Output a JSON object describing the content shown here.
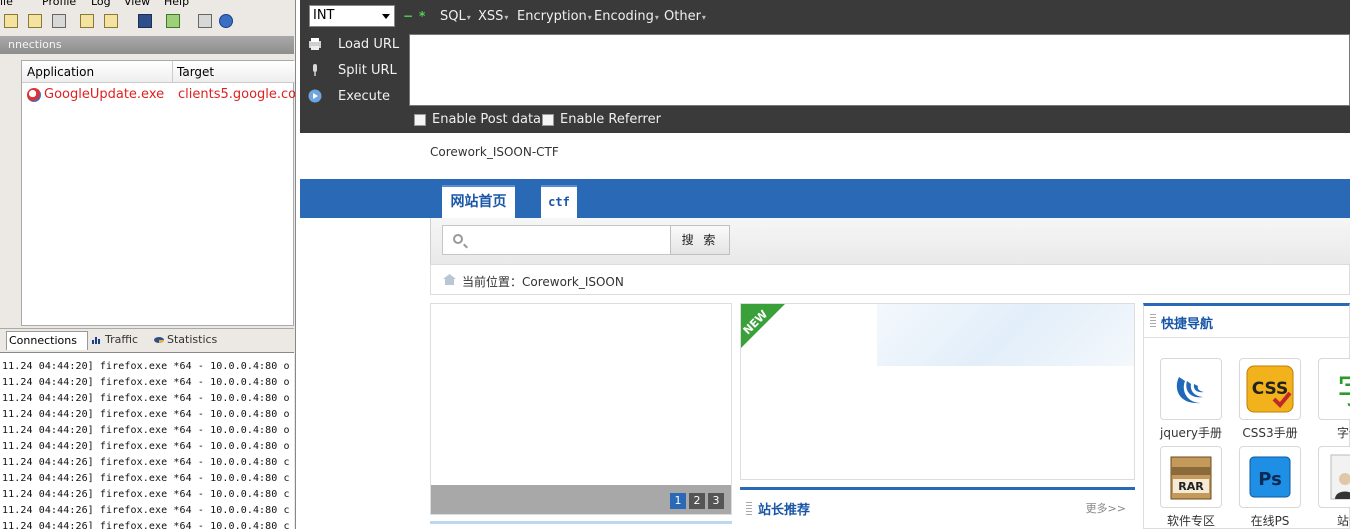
{
  "proxifier": {
    "menu": [
      "ile",
      "Profile",
      "Log",
      "View",
      "Help"
    ],
    "connections_title": "nnections",
    "table": {
      "columns": [
        "Application",
        "Target"
      ],
      "rows": [
        {
          "application": "GoogleUpdate.exe",
          "target": "clients5.google.com"
        }
      ]
    },
    "tabs": [
      "Connections",
      "Traffic",
      "Statistics"
    ],
    "log_lines": [
      "11.24 04:44:20] firefox.exe *64 - 10.0.0.4:80 o",
      "11.24 04:44:20] firefox.exe *64 - 10.0.0.4:80 o",
      "11.24 04:44:20] firefox.exe *64 - 10.0.0.4:80 o",
      "11.24 04:44:20] firefox.exe *64 - 10.0.0.4:80 o",
      "11.24 04:44:20] firefox.exe *64 - 10.0.0.4:80 o",
      "11.24 04:44:20] firefox.exe *64 - 10.0.0.4:80 o",
      "11.24 04:44:26] firefox.exe *64 - 10.0.0.4:80 c",
      "11.24 04:44:26] firefox.exe *64 - 10.0.0.4:80 c",
      "11.24 04:44:26] firefox.exe *64 - 10.0.0.4:80 c",
      "11.24 04:44:26] firefox.exe *64 - 10.0.0.4:80 c",
      "11.24 04:44:26] firefox.exe *64 - 10.0.0.4:80 c"
    ]
  },
  "hackbar": {
    "type_select": "INT",
    "menus": [
      "SQL",
      "XSS",
      "Encryption",
      "Encoding",
      "Other"
    ],
    "load_url": "Load URL",
    "split_url": "Split URL",
    "execute": "Execute",
    "url_value": "",
    "enable_post": "Enable Post data",
    "enable_referrer": "Enable Referrer"
  },
  "site": {
    "title": "Corework_ISOON-CTF",
    "nav_tabs": [
      "网站首页",
      "ctf"
    ],
    "search_button": "搜 索",
    "breadcrumb": "当前位置：Corework_ISOON",
    "slider_pages": [
      "1",
      "2",
      "3"
    ],
    "new_badge": "NEW",
    "recommend_title": "站长推荐",
    "recommend_more": "更多>>",
    "quick_nav_title": "快捷导航",
    "quick_items": [
      {
        "label": "jquery手册",
        "icon": "jquery-icon"
      },
      {
        "label": "CSS3手册",
        "icon": "css3-icon"
      },
      {
        "label": "字体",
        "icon": "font-icon"
      },
      {
        "label": "软件专区",
        "icon": "rar-icon"
      },
      {
        "label": "在线PS",
        "icon": "photoshop-icon"
      },
      {
        "label": "站长",
        "icon": "webmaster-icon"
      }
    ]
  },
  "colors": {
    "nav_blue": "#2a69b5",
    "hackbar_bg": "#3a3a3a",
    "app_red": "#e02020",
    "new_green": "#3aa13a"
  }
}
